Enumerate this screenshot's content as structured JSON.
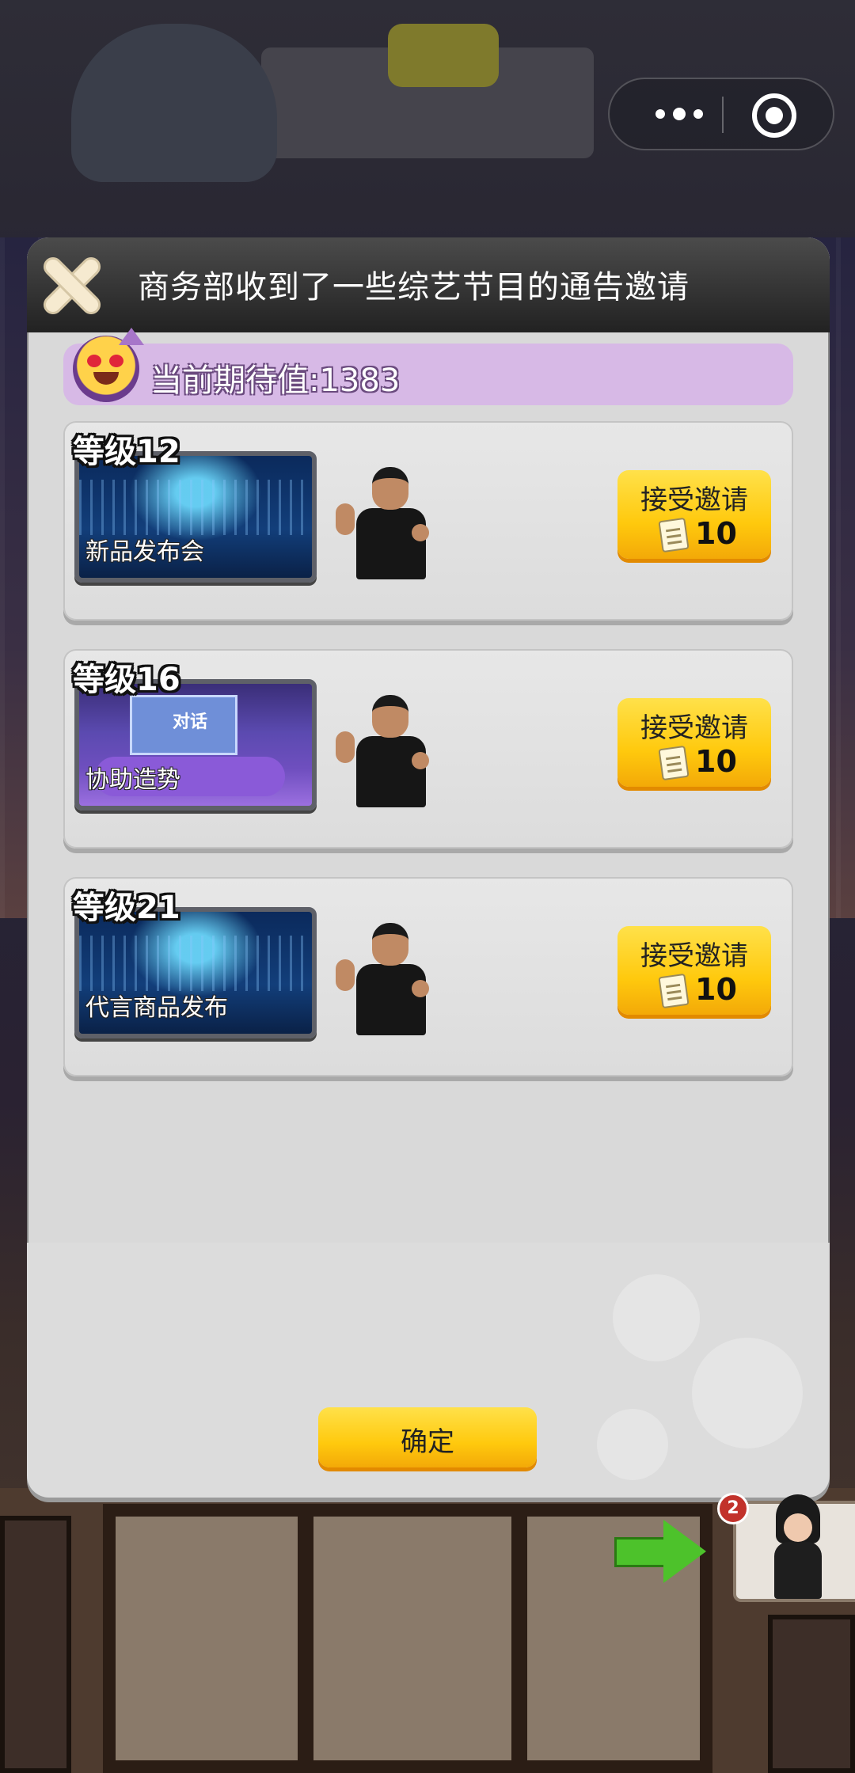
{
  "modal": {
    "title": "商务部收到了一些综艺节目的通告邀请",
    "expectation_text": "当前期待值:1383",
    "confirm_label": "确定"
  },
  "invitations": [
    {
      "level": "等级12",
      "show": "新品发布会",
      "accept_label": "接受邀请",
      "cost": "10"
    },
    {
      "level": "等级16",
      "show": "协助造势",
      "screen_text": "对话",
      "accept_label": "接受邀请",
      "cost": "10"
    },
    {
      "level": "等级21",
      "show": "代言商品发布",
      "accept_label": "接受邀请",
      "cost": "10"
    }
  ],
  "notification_badge": "2",
  "colors": {
    "accent_yellow": "#ffc90d",
    "header_dark": "#2a2a2a",
    "expect_bar": "#d7b9e6",
    "badge_red": "#c2322b"
  }
}
